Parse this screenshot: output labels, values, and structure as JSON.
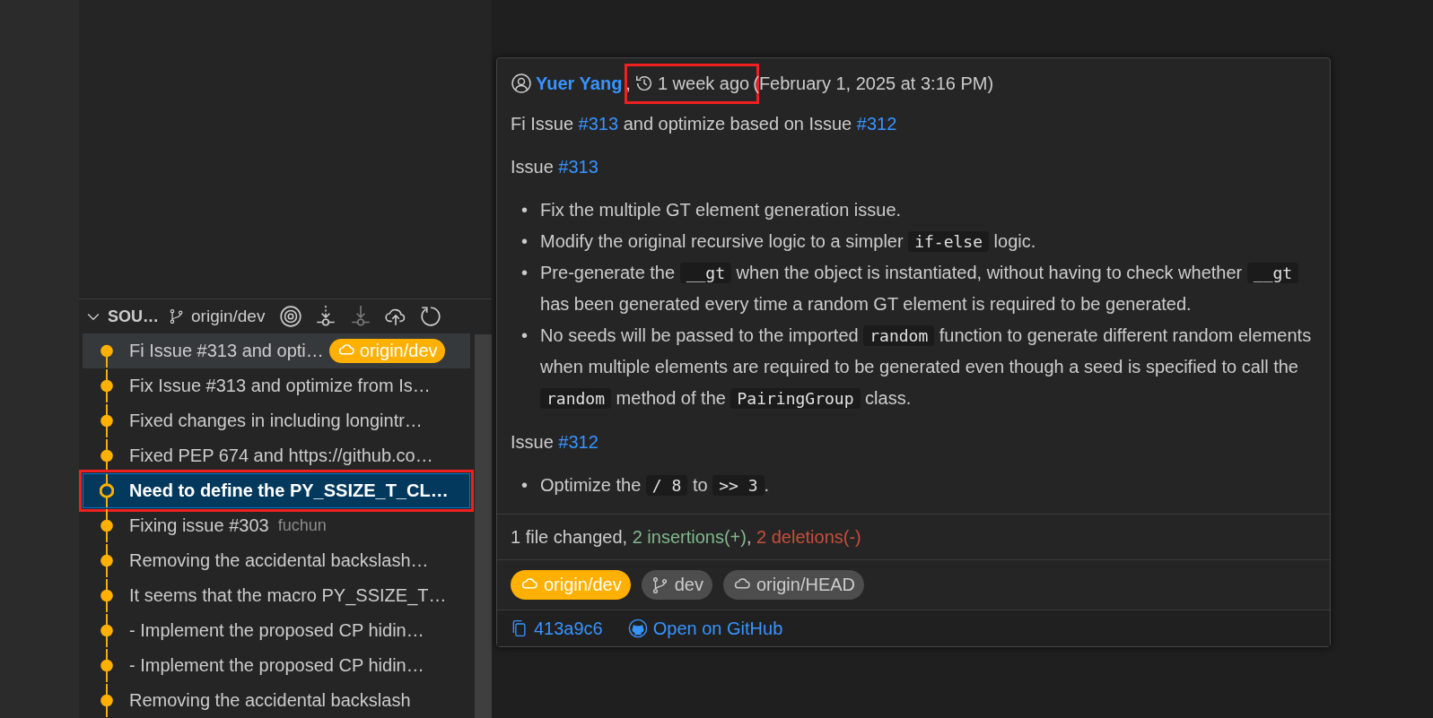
{
  "scm": {
    "title": "SOU…",
    "branch": "origin/dev",
    "commits": [
      {
        "message": "Fi Issue #313 and opti…",
        "hovered": true,
        "selected": false,
        "annotated": false,
        "ref": {
          "label": "origin/dev"
        }
      },
      {
        "message": "Fix Issue #313 and optimize from Is…",
        "hovered": false,
        "selected": false,
        "annotated": false
      },
      {
        "message": "Fixed changes in including longintr…",
        "hovered": false,
        "selected": false,
        "annotated": false
      },
      {
        "message": "Fixed PEP 674 and https://github.co…",
        "hovered": false,
        "selected": false,
        "annotated": false
      },
      {
        "message": "Need to define the PY_SSIZE_T_CL…",
        "hovered": false,
        "selected": true,
        "annotated": true
      },
      {
        "message": "Fixing issue #303",
        "author": "fuchun",
        "hovered": false,
        "selected": false,
        "annotated": false
      },
      {
        "message": "Removing the accidental backslash…",
        "hovered": false,
        "selected": false,
        "annotated": false
      },
      {
        "message": "It seems that the macro PY_SSIZE_T…",
        "hovered": false,
        "selected": false,
        "annotated": false
      },
      {
        "message": "- Implement the proposed CP hidin…",
        "hovered": false,
        "selected": false,
        "annotated": false
      },
      {
        "message": "- Implement the proposed CP hidin…",
        "hovered": false,
        "selected": false,
        "annotated": false
      },
      {
        "message": "Removing the accidental backslash",
        "hovered": false,
        "selected": false,
        "annotated": false
      }
    ]
  },
  "hover": {
    "author": "Yuer Yang",
    "separator": ",",
    "time_ago": "1 week ago",
    "time_annotated": true,
    "date": "(February 1, 2025 at 3:16 PM)",
    "body": [
      {
        "kind": "paragraph",
        "parts": [
          {
            "kind": "text",
            "text": "Fi Issue "
          },
          {
            "kind": "link",
            "text": "#313"
          },
          {
            "kind": "text",
            "text": " and optimize based on Issue "
          },
          {
            "kind": "link",
            "text": "#312"
          }
        ]
      },
      {
        "kind": "paragraph",
        "parts": [
          {
            "kind": "text",
            "text": "Issue "
          },
          {
            "kind": "link",
            "text": "#313"
          }
        ]
      },
      {
        "kind": "list",
        "marker": "•",
        "items": [
          [
            {
              "kind": "text",
              "text": "Fix the multiple GT element generation issue."
            }
          ],
          [
            {
              "kind": "text",
              "text": "Modify the original recursive logic to a simpler "
            },
            {
              "kind": "code",
              "text": "if-else"
            },
            {
              "kind": "text",
              "text": " logic."
            }
          ],
          [
            {
              "kind": "text",
              "text": "Pre-generate the "
            },
            {
              "kind": "code",
              "text": "__gt"
            },
            {
              "kind": "text",
              "text": " when the object is instantiated, without having to check whether "
            },
            {
              "kind": "code",
              "text": "__gt"
            },
            {
              "kind": "text",
              "text": " has been generated every time a random GT element is required to be generated."
            }
          ],
          [
            {
              "kind": "text",
              "text": "No seeds will be passed to the imported "
            },
            {
              "kind": "code",
              "text": "random"
            },
            {
              "kind": "text",
              "text": " function to generate different random elements when multiple elements are required to be generated even though a seed is specified to call the "
            },
            {
              "kind": "code",
              "text": "random"
            },
            {
              "kind": "text",
              "text": " method of the "
            },
            {
              "kind": "code",
              "text": "PairingGroup"
            },
            {
              "kind": "text",
              "text": " class."
            }
          ]
        ]
      },
      {
        "kind": "paragraph",
        "parts": [
          {
            "kind": "text",
            "text": "Issue "
          },
          {
            "kind": "link",
            "text": "#312"
          }
        ]
      },
      {
        "kind": "list",
        "marker": "•",
        "items": [
          [
            {
              "kind": "text",
              "text": "Optimize the "
            },
            {
              "kind": "code",
              "text": "/ 8"
            },
            {
              "kind": "text",
              "text": " to "
            },
            {
              "kind": "code",
              "text": ">> 3"
            },
            {
              "kind": "text",
              "text": "."
            }
          ]
        ]
      }
    ],
    "stats": [
      {
        "kind": "plain",
        "text": "1 file changed, "
      },
      {
        "kind": "insertions",
        "text": "2 insertions(+)"
      },
      {
        "kind": "plain",
        "text": ", "
      },
      {
        "kind": "deletions",
        "text": "2 deletions(-)"
      }
    ],
    "refs": [
      {
        "label": "origin/dev",
        "kind": "remote",
        "current": true
      },
      {
        "label": "dev",
        "kind": "branch",
        "current": false
      },
      {
        "label": "origin/HEAD",
        "kind": "remote",
        "current": false
      }
    ],
    "sha": "413a9c6",
    "open_link": "Open on GitHub"
  }
}
